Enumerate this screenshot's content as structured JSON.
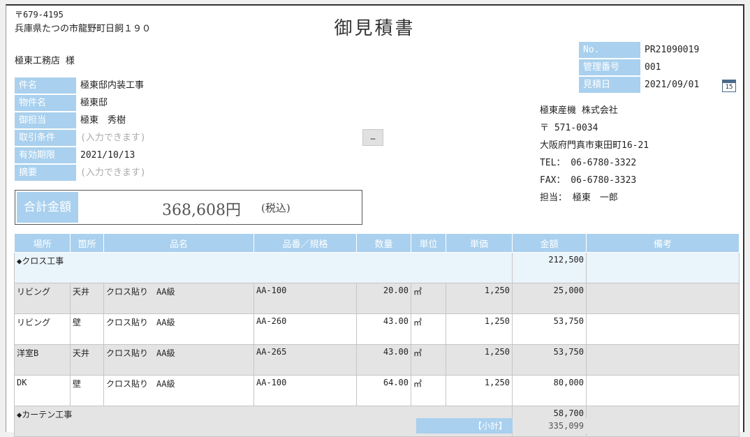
{
  "sender": {
    "postal": "〒679-4195",
    "address": "兵庫県たつの市龍野町日飼１９０"
  },
  "title": "御見積書",
  "customer": "極東工務店 様",
  "fields": [
    {
      "label": "件名",
      "value": "極東邸内装工事",
      "placeholder": false
    },
    {
      "label": "物件名",
      "value": "極東邸",
      "placeholder": false
    },
    {
      "label": "御担当",
      "value": "極東　秀樹",
      "placeholder": false
    },
    {
      "label": "取引条件",
      "value": "(入力できます)",
      "placeholder": true
    },
    {
      "label": "有効期限",
      "value": "2021/10/13",
      "placeholder": false
    },
    {
      "label": "摘要",
      "value": "(入力できます)",
      "placeholder": true
    }
  ],
  "more_button": "…",
  "total": {
    "label": "合計金額",
    "value": "368,608円",
    "tax": "(税込)"
  },
  "meta": [
    {
      "label": "No.",
      "value": "PR21090019"
    },
    {
      "label": "管理番号",
      "value": "001"
    },
    {
      "label": "見積日",
      "value": "2021/09/01"
    }
  ],
  "calendar_icon": {
    "day": "15"
  },
  "company": {
    "name": "極東産機 株式会社",
    "postal": "〒 571-0034",
    "address": "大阪府門真市東田町16-21",
    "tel": "TEL： 06-6780-3322",
    "fax": "FAX： 06-6780-3323",
    "contact": "担当： 極東　一郎"
  },
  "table": {
    "headers": [
      "場所",
      "箇所",
      "品名",
      "品番／規格",
      "数量",
      "単位",
      "単価",
      "金額",
      "備考"
    ],
    "rows": [
      {
        "type": "cat",
        "name": "◆クロス工事",
        "amount": "212,500"
      },
      {
        "type": "item",
        "place": "リビング",
        "spot": "天井",
        "item": "クロス貼り　AA級",
        "spec": "AA-100",
        "qty": "20.00",
        "unit": "㎡",
        "price": "1,250",
        "amount": "25,000",
        "note": ""
      },
      {
        "type": "item",
        "place": "リビング",
        "spot": "壁",
        "item": "クロス貼り　AA級",
        "spec": "AA-260",
        "qty": "43.00",
        "unit": "㎡",
        "price": "1,250",
        "amount": "53,750",
        "note": ""
      },
      {
        "type": "item",
        "place": "洋室B",
        "spot": "天井",
        "item": "クロス貼り　AA級",
        "spec": "AA-265",
        "qty": "43.00",
        "unit": "㎡",
        "price": "1,250",
        "amount": "53,750",
        "note": ""
      },
      {
        "type": "item",
        "place": "DK",
        "spot": "壁",
        "item": "クロス貼り　AA級",
        "spec": "AA-100",
        "qty": "64.00",
        "unit": "㎡",
        "price": "1,250",
        "amount": "80,000",
        "note": ""
      },
      {
        "type": "cat",
        "name": "◆カーテン工事",
        "amount": "58,700"
      }
    ]
  },
  "subtotal": {
    "label": "【小計】",
    "value": "335,099"
  }
}
